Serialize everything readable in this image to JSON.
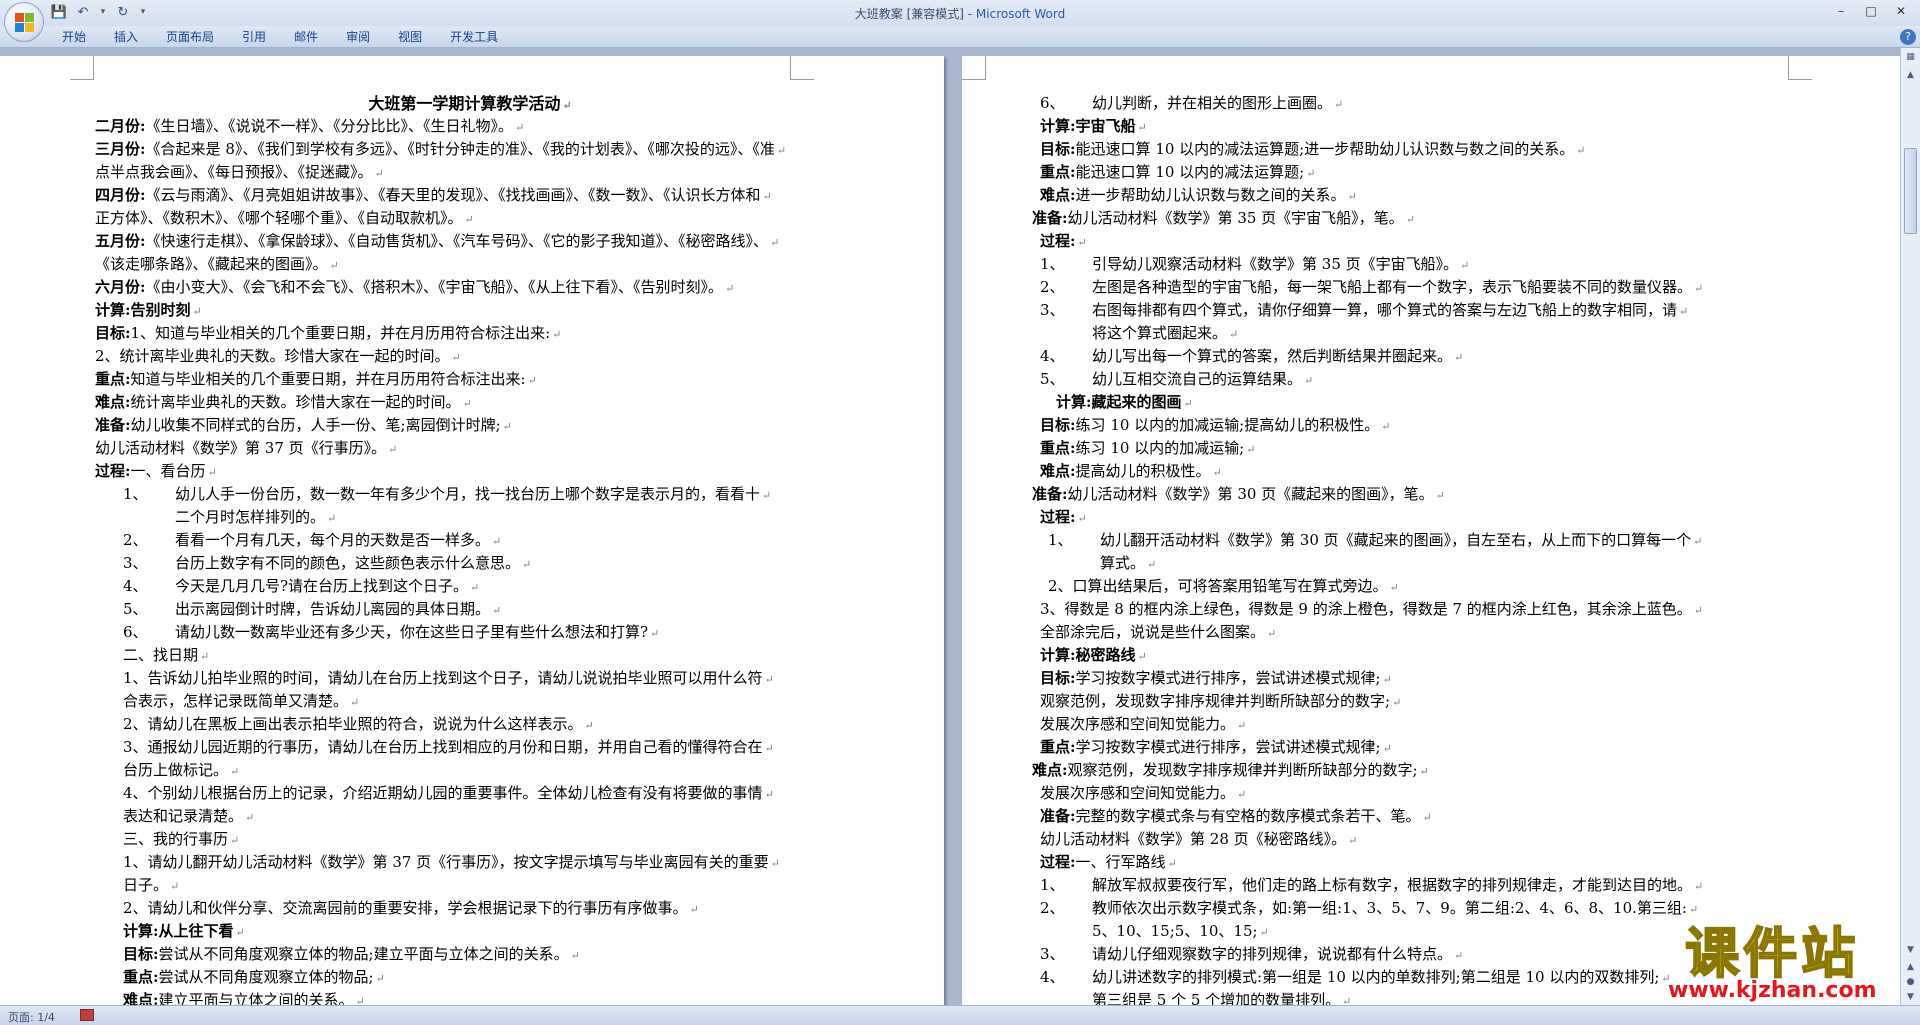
{
  "titlebar": {
    "title": "大班教案 [兼容模式] - ",
    "app": "Microsoft Word"
  },
  "quick_access": [
    "save-icon",
    "undo-icon",
    "redo-icon",
    "customize-icon"
  ],
  "ribbon": {
    "tabs": [
      "开始",
      "插入",
      "页面布局",
      "引用",
      "邮件",
      "审阅",
      "视图",
      "开发工具"
    ]
  },
  "status": {
    "page": "页面: 1/4"
  },
  "watermark": {
    "title": "课件站",
    "url": "www.kjzhan.com"
  },
  "page1": {
    "lines": [
      {
        "t": "title",
        "text": "大班第一学期计算教学活动"
      },
      {
        "t": "p",
        "b": "二月份:",
        "text": "《生日墙》、《说说不一样》、《分分比比》、《生日礼物》。"
      },
      {
        "t": "p",
        "b": "三月份:",
        "text": "《合起来是 8》、《我们到学校有多远》、《时针分钟走的准》、《我的计划表》、《哪次投的远》、《准"
      },
      {
        "t": "p",
        "text": "点半点我会画》、《每日预报》、《捉迷藏》。"
      },
      {
        "t": "p",
        "b": "四月份:",
        "text": "《云与雨滴》、《月亮姐姐讲故事》、《春天里的发现》、《找找画画》、《数一数》、《认识长方体和"
      },
      {
        "t": "p",
        "text": "正方体》、《数积木》、《哪个轻哪个重》、《自动取款机》。"
      },
      {
        "t": "p",
        "b": "五月份:",
        "text": "《快速行走棋》、《拿保龄球》、《自动售货机》、《汽车号码》、《它的影子我知道》、《秘密路线》、"
      },
      {
        "t": "p",
        "text": "《该走哪条路》、《藏起来的图画》。"
      },
      {
        "t": "p",
        "b": "六月份:",
        "text": "《由小变大》、《会飞和不会飞》、《搭积木》、《宇宙飞船》、《从上往下看》、《告别时刻》。"
      },
      {
        "t": "p",
        "b": "计算:告别时刻",
        "text": ""
      },
      {
        "t": "p",
        "b": "目标:",
        "text": "1、知道与毕业相关的几个重要日期，并在月历用符合标注出来:"
      },
      {
        "t": "p",
        "text": "2、统计离毕业典礼的天数。珍惜大家在一起的时间。"
      },
      {
        "t": "p",
        "b": "重点:",
        "text": "知道与毕业相关的几个重要日期，并在月历用符合标注出来:"
      },
      {
        "t": "p",
        "b": "难点:",
        "text": "统计离毕业典礼的天数。珍惜大家在一起的时间。"
      },
      {
        "t": "p",
        "b": "准备:",
        "text": "幼儿收集不同样式的台历，人手一份、笔;离园倒计时牌;"
      },
      {
        "t": "p",
        "text": "幼儿活动材料《数学》第 37 页《行事历》。"
      },
      {
        "t": "p",
        "b": "过程:",
        "text": "一、看台历"
      },
      {
        "t": "n",
        "indent": 28,
        "num": "1、",
        "text": "幼儿人手一份台历，数一数一年有多少个月，找一找台历上哪个数字是表示月的，看看十"
      },
      {
        "t": "p",
        "indent": 80,
        "text": "二个月时怎样排列的。"
      },
      {
        "t": "n",
        "indent": 28,
        "num": "2、",
        "text": "看看一个月有几天，每个月的天数是否一样多。"
      },
      {
        "t": "n",
        "indent": 28,
        "num": "3、",
        "text": "台历上数字有不同的颜色，这些颜色表示什么意思。"
      },
      {
        "t": "n",
        "indent": 28,
        "num": "4、",
        "text": "今天是几月几号?请在台历上找到这个日子。"
      },
      {
        "t": "n",
        "indent": 28,
        "num": "5、",
        "text": "出示离园倒计时牌，告诉幼儿离园的具体日期。"
      },
      {
        "t": "n",
        "indent": 28,
        "num": "6、",
        "text": "请幼儿数一数离毕业还有多少天，你在这些日子里有些什么想法和打算?"
      },
      {
        "t": "p",
        "indent": 28,
        "text": "二、找日期"
      },
      {
        "t": "p",
        "indent": 28,
        "text": "1、告诉幼儿拍毕业照的时间，请幼儿在台历上找到这个日子，请幼儿说说拍毕业照可以用什么符"
      },
      {
        "t": "p",
        "indent": 28,
        "text": "合表示，怎样记录既简单又清楚。"
      },
      {
        "t": "p",
        "indent": 28,
        "text": "2、请幼儿在黑板上画出表示拍毕业照的符合，说说为什么这样表示。"
      },
      {
        "t": "p",
        "indent": 28,
        "text": "3、通报幼儿园近期的行事历，请幼儿在台历上找到相应的月份和日期，并用自己看的懂得符合在"
      },
      {
        "t": "p",
        "indent": 28,
        "text": "台历上做标记。"
      },
      {
        "t": "p",
        "indent": 28,
        "text": "4、个别幼儿根据台历上的记录，介绍近期幼儿园的重要事件。全体幼儿检查有没有将要做的事情"
      },
      {
        "t": "p",
        "indent": 28,
        "text": "表达和记录清楚。"
      },
      {
        "t": "p",
        "indent": 28,
        "text": "三、我的行事历"
      },
      {
        "t": "p",
        "indent": 28,
        "text": "1、请幼儿翻开幼儿活动材料《数学》第 37 页《行事历》，按文字提示填写与毕业离园有关的重要"
      },
      {
        "t": "p",
        "indent": 28,
        "text": "日子。"
      },
      {
        "t": "p",
        "indent": 28,
        "text": "2、请幼儿和伙伴分享、交流离园前的重要安排，学会根据记录下的行事历有序做事。"
      },
      {
        "t": "p",
        "indent": 28,
        "b": "计算:从上往下看",
        "text": ""
      },
      {
        "t": "p",
        "indent": 28,
        "b": "目标:",
        "text": "尝试从不同角度观察立体的物品;建立平面与立体之间的关系。"
      },
      {
        "t": "p",
        "indent": 28,
        "b": "重点:",
        "text": "尝试从不同角度观察立体的物品;"
      },
      {
        "t": "p",
        "indent": 28,
        "b": "难点:",
        "text": "建立平面与立体之间的关系。"
      }
    ]
  },
  "page2": {
    "lines": [
      {
        "t": "n",
        "indent": 8,
        "num": "6、",
        "text": "幼儿判断，并在相关的图形上画圈。"
      },
      {
        "t": "p",
        "indent": 8,
        "b": "计算:宇宙飞船",
        "text": ""
      },
      {
        "t": "p",
        "indent": 8,
        "b": "目标:",
        "text": "能迅速口算 10 以内的减法运算题;进一步帮助幼儿认识数与数之间的关系。"
      },
      {
        "t": "p",
        "indent": 8,
        "b": "重点:",
        "text": "能迅速口算 10 以内的减法运算题;"
      },
      {
        "t": "p",
        "indent": 8,
        "b": "难点:",
        "text": "进一步帮助幼儿认识数与数之间的关系。"
      },
      {
        "t": "p",
        "b": "准备:",
        "text": "幼儿活动材料《数学》第 35 页《宇宙飞船》，笔。"
      },
      {
        "t": "p",
        "indent": 8,
        "b": "过程:",
        "text": ""
      },
      {
        "t": "n",
        "indent": 8,
        "num": "1、",
        "text": "引导幼儿观察活动材料《数学》第 35 页《宇宙飞船》。"
      },
      {
        "t": "n",
        "indent": 8,
        "num": "2、",
        "text": "左图是各种造型的宇宙飞船，每一架飞船上都有一个数字，表示飞船要装不同的数量仪器。"
      },
      {
        "t": "n",
        "indent": 8,
        "num": "3、",
        "text": "右图每排都有四个算式，请你仔细算一算，哪个算式的答案与左边飞船上的数字相同，请"
      },
      {
        "t": "p",
        "indent": 60,
        "text": "将这个算式圈起来。"
      },
      {
        "t": "n",
        "indent": 8,
        "num": "4、",
        "text": "幼儿写出每一个算式的答案，然后判断结果并圈起来。"
      },
      {
        "t": "n",
        "indent": 8,
        "num": "5、",
        "text": "幼儿互相交流自己的运算结果。"
      },
      {
        "t": "p",
        "indent": 24,
        "b": "计算:藏起来的图画",
        "text": ""
      },
      {
        "t": "p",
        "indent": 8,
        "b": "目标:",
        "text": "练习 10 以内的加减运输;提高幼儿的积极性。"
      },
      {
        "t": "p",
        "indent": 8,
        "b": "重点:",
        "text": "练习 10 以内的加减运输;"
      },
      {
        "t": "p",
        "indent": 8,
        "b": "难点:",
        "text": "提高幼儿的积极性。"
      },
      {
        "t": "p",
        "b": "准备:",
        "text": "幼儿活动材料《数学》第 30 页《藏起来的图画》，笔。"
      },
      {
        "t": "p",
        "indent": 8,
        "b": "过程:",
        "text": ""
      },
      {
        "t": "n",
        "indent": 16,
        "num": "1、",
        "text": "幼儿翻开活动材料《数学》第 30 页《藏起来的图画》，自左至右，从上而下的口算每一个"
      },
      {
        "t": "p",
        "indent": 68,
        "text": "算式。"
      },
      {
        "t": "p",
        "indent": 16,
        "text": "2、口算出结果后，可将答案用铅笔写在算式旁边。"
      },
      {
        "t": "p",
        "indent": 8,
        "text": "3、得数是 8 的框内涂上绿色，得数是 9 的涂上橙色，得数是 7 的框内涂上红色，其余涂上蓝色。"
      },
      {
        "t": "p",
        "indent": 8,
        "text": "全部涂完后，说说是些什么图案。"
      },
      {
        "t": "p",
        "indent": 8,
        "b": "计算:秘密路线",
        "text": ""
      },
      {
        "t": "p",
        "indent": 8,
        "b": "目标:",
        "text": "学习按数字模式进行排序，尝试讲述模式规律;"
      },
      {
        "t": "p",
        "indent": 8,
        "text": "观察范例，发现数字排序规律并判断所缺部分的数字;"
      },
      {
        "t": "p",
        "indent": 8,
        "text": "发展次序感和空间知觉能力。"
      },
      {
        "t": "p",
        "indent": 8,
        "b": "重点:",
        "text": "学习按数字模式进行排序，尝试讲述模式规律;"
      },
      {
        "t": "p",
        "b": "难点:",
        "text": "观察范例，发现数字排序规律并判断所缺部分的数字;"
      },
      {
        "t": "p",
        "indent": 8,
        "text": "发展次序感和空间知觉能力。"
      },
      {
        "t": "p",
        "indent": 8,
        "b": "准备:",
        "text": "完整的数字模式条与有空格的数序模式条若干、笔。"
      },
      {
        "t": "p",
        "indent": 8,
        "text": "幼儿活动材料《数学》第 28 页《秘密路线》。"
      },
      {
        "t": "p",
        "indent": 8,
        "b": "过程:",
        "text": "一、行军路线"
      },
      {
        "t": "n",
        "indent": 8,
        "num": "1、",
        "text": "解放军叔叔要夜行军，他们走的路上标有数字，根据数字的排列规律走，才能到达目的地。"
      },
      {
        "t": "n",
        "indent": 8,
        "num": "2、",
        "text": "教师依次出示数字模式条，如:第一组:1、3、5、7、9。第二组:2、4、6、8、10.第三组:"
      },
      {
        "t": "p",
        "indent": 60,
        "text": "5、10、15;5、10、15;"
      },
      {
        "t": "n",
        "indent": 8,
        "num": "3、",
        "text": "请幼儿仔细观察数字的排列规律，说说都有什么特点。"
      },
      {
        "t": "n",
        "indent": 8,
        "num": "4、",
        "text": "幼儿讲述数字的排列模式:第一组是 10 以内的单数排列;第二组是 10 以内的双数排列;"
      },
      {
        "t": "p",
        "indent": 60,
        "text": "第三组是 5 个 5 个增加的数量排列。"
      }
    ]
  }
}
